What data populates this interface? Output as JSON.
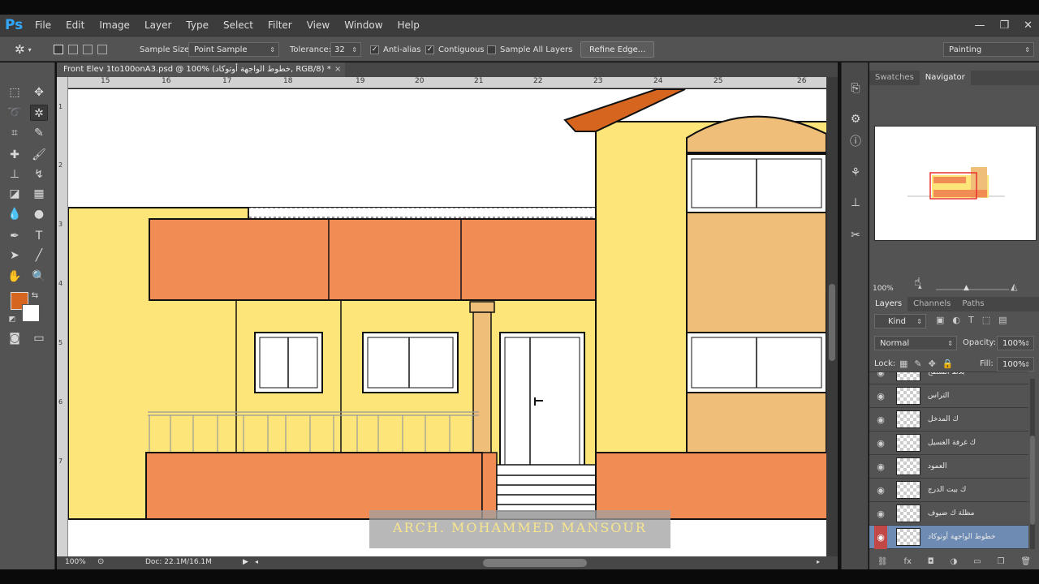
{
  "app": {
    "logo": "Ps"
  },
  "menu": [
    "File",
    "Edit",
    "Image",
    "Layer",
    "Type",
    "Select",
    "Filter",
    "View",
    "Window",
    "Help"
  ],
  "window_controls": {
    "minimize": "—",
    "restore": "❐",
    "close": "✕"
  },
  "options": {
    "sample_size_label": "Sample Size:",
    "sample_size_value": "Point Sample",
    "tolerance_label": "Tolerance:",
    "tolerance_value": "32",
    "anti_alias_label": "Anti-alias",
    "anti_alias_checked": true,
    "contiguous_label": "Contiguous",
    "contiguous_checked": true,
    "sample_all_layers_label": "Sample All Layers",
    "sample_all_layers_checked": false,
    "refine_edge_label": "Refine Edge...",
    "workspace_value": "Painting"
  },
  "document": {
    "tab_title": "Front Elev 1to100onA3.psd @ 100% (خطوط الواجهة أوتوكاد, RGB/8) *",
    "close_glyph": "×",
    "ruler_labels": [
      "15",
      "16",
      "17",
      "18",
      "19",
      "20",
      "21",
      "22",
      "23",
      "24",
      "25",
      "26"
    ],
    "vruler_labels": [
      "1",
      "2",
      "3",
      "4",
      "5",
      "6",
      "7"
    ]
  },
  "canvas": {
    "watermark": "ARCH. MOHAMMED MANSOUR",
    "colors": {
      "wall": "#fde57a",
      "orange": "#f28c55",
      "tan": "#efbe79",
      "roof": "#d6661f",
      "outline": "#111111"
    }
  },
  "status": {
    "zoom": "100%",
    "doc": "Doc: 22.1M/16.1M"
  },
  "panels": {
    "top_tabs": [
      "Swatches",
      "Navigator"
    ],
    "navigator_zoom": "100%",
    "layer_tabs": [
      "Layers",
      "Channels",
      "Paths"
    ],
    "kind_label": "Kind",
    "blend_mode": "Normal",
    "opacity_label": "Opacity:",
    "opacity_value": "100%",
    "lock_label": "Lock:",
    "fill_label": "Fill:",
    "fill_value": "100%"
  },
  "layers": [
    {
      "name": "بلاط السطح",
      "selected": false
    },
    {
      "name": "التراس",
      "selected": false
    },
    {
      "name": "ك المدخل",
      "selected": false
    },
    {
      "name": "ك غرفة الغسيل",
      "selected": false
    },
    {
      "name": "العمود",
      "selected": false
    },
    {
      "name": "ك بيت الدرج",
      "selected": false
    },
    {
      "name": "مظلة ك ضيوف",
      "selected": false
    },
    {
      "name": "خطوط الواجهة أوتوكاد",
      "selected": true
    }
  ]
}
